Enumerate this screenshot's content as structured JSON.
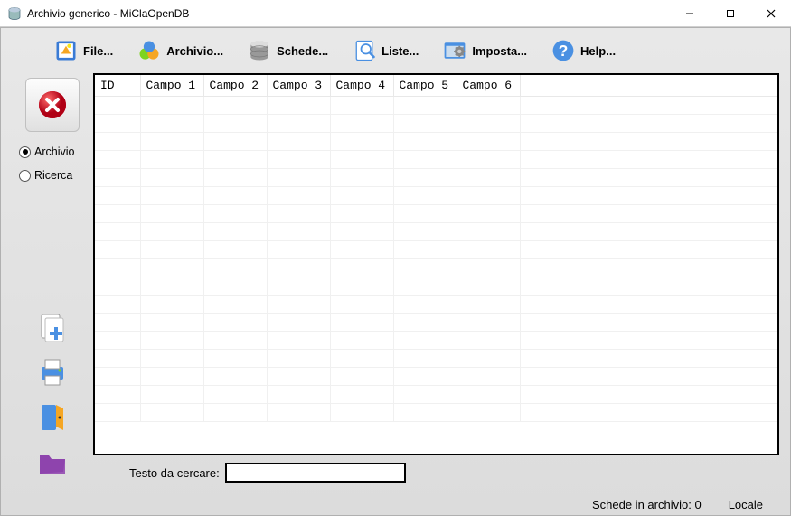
{
  "window": {
    "title": "Archivio generico - MiClaOpenDB"
  },
  "toolbar": {
    "file": "File...",
    "archivio": "Archivio...",
    "schede": "Schede...",
    "liste": "Liste...",
    "imposta": "Imposta...",
    "help": "Help..."
  },
  "sidebar": {
    "radio_archivio": "Archivio",
    "radio_ricerca": "Ricerca"
  },
  "grid": {
    "columns": [
      "ID",
      "Campo 1",
      "Campo 2",
      "Campo 3",
      "Campo 4",
      "Campo 5",
      "Campo 6"
    ]
  },
  "search": {
    "label": "Testo da cercare:",
    "value": ""
  },
  "status": {
    "schede_label": "Schede in archivio:",
    "schede_count": "0",
    "locale": "Locale"
  }
}
